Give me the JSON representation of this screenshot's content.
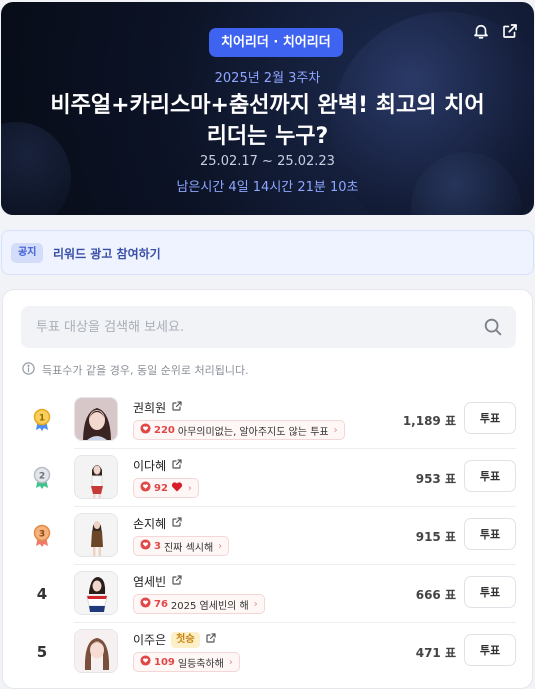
{
  "header": {
    "category": "치어리더 · 치어리더",
    "week": "2025년 2월 3주차",
    "title": "비주얼+카리스마+춤선까지 완벽! 최고의 치어리더는 누구?",
    "dates": "25.02.17 ~ 25.02.23",
    "remaining": "남은시간 4일 14시간 21분 10초",
    "icons": [
      "bell-icon",
      "share-icon"
    ]
  },
  "notice": {
    "tag": "공지",
    "text": "리워드 광고 참여하기"
  },
  "search": {
    "placeholder": "투표 대상을 검색해 보세요.",
    "value": ""
  },
  "info_text": "득표수가 같을 경우, 동일 순위로 처리됩니다.",
  "candidates": [
    {
      "rank": "1",
      "name": "권희원",
      "badge": "",
      "comment_count": "220",
      "comment": "아무의미없는, 알아주지도 않는 투표",
      "votes": "1,189 표",
      "vote_label": "투표"
    },
    {
      "rank": "2",
      "name": "이다혜",
      "badge": "",
      "comment_count": "92",
      "comment": "",
      "votes": "953 표",
      "vote_label": "투표"
    },
    {
      "rank": "3",
      "name": "손지혜",
      "badge": "",
      "comment_count": "3",
      "comment": "진짜 섹시해",
      "votes": "915 표",
      "vote_label": "투표"
    },
    {
      "rank": "4",
      "name": "염세빈",
      "badge": "",
      "comment_count": "76",
      "comment": "2025 염세빈의 해",
      "votes": "666 표",
      "vote_label": "투표"
    },
    {
      "rank": "5",
      "name": "이주은",
      "badge": "첫승",
      "comment_count": "109",
      "comment": "일등축하해",
      "votes": "471 표",
      "vote_label": "투표"
    }
  ],
  "colors": {
    "accent": "#3d63f0",
    "heart": "#e04848",
    "gold": "#f2b632",
    "silver": "#c9ced6",
    "bronze": "#e8945a"
  }
}
